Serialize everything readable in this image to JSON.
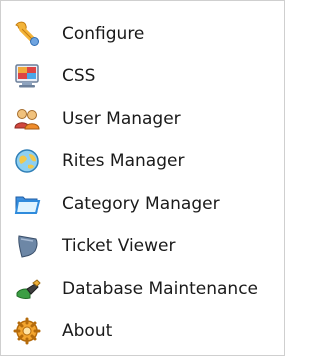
{
  "menu": {
    "items": [
      {
        "label": "Configure",
        "icon": "wrench-icon"
      },
      {
        "label": "CSS",
        "icon": "monitor-palette-icon"
      },
      {
        "label": "User Manager",
        "icon": "users-icon"
      },
      {
        "label": "Rites Manager",
        "icon": "globe-icon"
      },
      {
        "label": "Category Manager",
        "icon": "folder-icon"
      },
      {
        "label": "Ticket Viewer",
        "icon": "ticket-icon"
      },
      {
        "label": "Database Maintenance",
        "icon": "database-brush-icon"
      },
      {
        "label": "About",
        "icon": "gear-info-icon"
      }
    ]
  }
}
